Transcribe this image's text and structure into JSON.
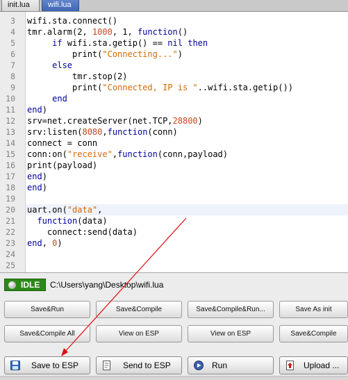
{
  "tabs": [
    {
      "label": "init.lua",
      "active": false
    },
    {
      "label": "wifi.lua",
      "active": true
    }
  ],
  "editor": {
    "lines": [
      {
        "n": "3",
        "segs": [
          {
            "t": "wifi.sta.connect()"
          }
        ]
      },
      {
        "n": "4",
        "segs": [
          {
            "t": "tmr.alarm(2, "
          },
          {
            "t": "1000",
            "c": "num"
          },
          {
            "t": ", 1, "
          },
          {
            "t": "function",
            "c": "kw"
          },
          {
            "t": "()"
          }
        ]
      },
      {
        "n": "5",
        "segs": [
          {
            "t": "     "
          },
          {
            "t": "if",
            "c": "kw"
          },
          {
            "t": " wifi.sta.getip() == "
          },
          {
            "t": "nil",
            "c": "kw"
          },
          {
            "t": " "
          },
          {
            "t": "then",
            "c": "kw"
          }
        ]
      },
      {
        "n": "6",
        "segs": [
          {
            "t": "         print("
          },
          {
            "t": "\"Connecting...\"",
            "c": "str"
          },
          {
            "t": ")"
          }
        ]
      },
      {
        "n": "7",
        "segs": [
          {
            "t": "     "
          },
          {
            "t": "else",
            "c": "kw"
          }
        ]
      },
      {
        "n": "8",
        "segs": [
          {
            "t": "         tmr.stop(2)"
          }
        ]
      },
      {
        "n": "9",
        "segs": [
          {
            "t": "         print("
          },
          {
            "t": "\"Connected, IP is \"",
            "c": "str"
          },
          {
            "t": "..wifi.sta.getip())"
          }
        ]
      },
      {
        "n": "10",
        "segs": [
          {
            "t": "     "
          },
          {
            "t": "end",
            "c": "kw"
          }
        ]
      },
      {
        "n": "11",
        "segs": [
          {
            "t": "end",
            "c": "kw"
          },
          {
            "t": ")"
          }
        ]
      },
      {
        "n": "12",
        "segs": [
          {
            "t": "srv=net.createServer(net.TCP,"
          },
          {
            "t": "28800",
            "c": "num"
          },
          {
            "t": ")"
          }
        ]
      },
      {
        "n": "13",
        "segs": [
          {
            "t": "srv:listen("
          },
          {
            "t": "8080",
            "c": "num"
          },
          {
            "t": ","
          },
          {
            "t": "function",
            "c": "kw"
          },
          {
            "t": "(conn)"
          }
        ]
      },
      {
        "n": "14",
        "segs": [
          {
            "t": "connect = conn"
          }
        ]
      },
      {
        "n": "15",
        "segs": [
          {
            "t": "conn:on("
          },
          {
            "t": "\"receive\"",
            "c": "str"
          },
          {
            "t": ","
          },
          {
            "t": "function",
            "c": "kw"
          },
          {
            "t": "(conn,payload)"
          }
        ]
      },
      {
        "n": "16",
        "segs": [
          {
            "t": "print(payload)"
          }
        ]
      },
      {
        "n": "17",
        "segs": [
          {
            "t": "end",
            "c": "kw"
          },
          {
            "t": ")"
          }
        ]
      },
      {
        "n": "18",
        "segs": [
          {
            "t": "end",
            "c": "kw"
          },
          {
            "t": ")"
          }
        ]
      },
      {
        "n": "19",
        "segs": []
      },
      {
        "n": "20",
        "segs": [
          {
            "t": "uart.on("
          },
          {
            "t": "\"data\"",
            "c": "str"
          },
          {
            "t": ","
          }
        ],
        "current": true
      },
      {
        "n": "21",
        "segs": [
          {
            "t": "  "
          },
          {
            "t": "function",
            "c": "kw"
          },
          {
            "t": "(data)"
          }
        ]
      },
      {
        "n": "22",
        "segs": [
          {
            "t": "    connect:send(data)"
          }
        ]
      },
      {
        "n": "23",
        "segs": [
          {
            "t": "end",
            "c": "kw"
          },
          {
            "t": ", "
          },
          {
            "t": "0",
            "c": "num"
          },
          {
            "t": ")"
          }
        ]
      },
      {
        "n": "24",
        "segs": []
      },
      {
        "n": "25",
        "segs": []
      }
    ]
  },
  "status": {
    "state": "IDLE",
    "file_path": "C:\\Users\\yang\\Desktop\\wifi.lua"
  },
  "snippet_buttons": {
    "row1": [
      "Save&Run",
      "Save&Compile",
      "Save&Compile&Run...",
      "Save As init"
    ],
    "row2": [
      "Save&Compile All",
      "View on ESP",
      "View on ESP",
      "Save&Compile"
    ]
  },
  "bottom_buttons": {
    "save_to_esp": "Save to ESP",
    "send_to_esp": "Send to ESP",
    "run": "Run",
    "upload": "Upload ..."
  },
  "colors": {
    "keyword": "#00009c",
    "string": "#d46a00",
    "number": "#c4481b",
    "status_idle": "#2b8a17",
    "annotation_arrow": "#e01010",
    "active_tab": "#3f66b6"
  },
  "icons": {
    "status": "status-led-icon",
    "save": "floppy-disk-icon",
    "send": "send-document-icon",
    "run": "play-circle-icon",
    "upload": "upload-file-icon"
  }
}
